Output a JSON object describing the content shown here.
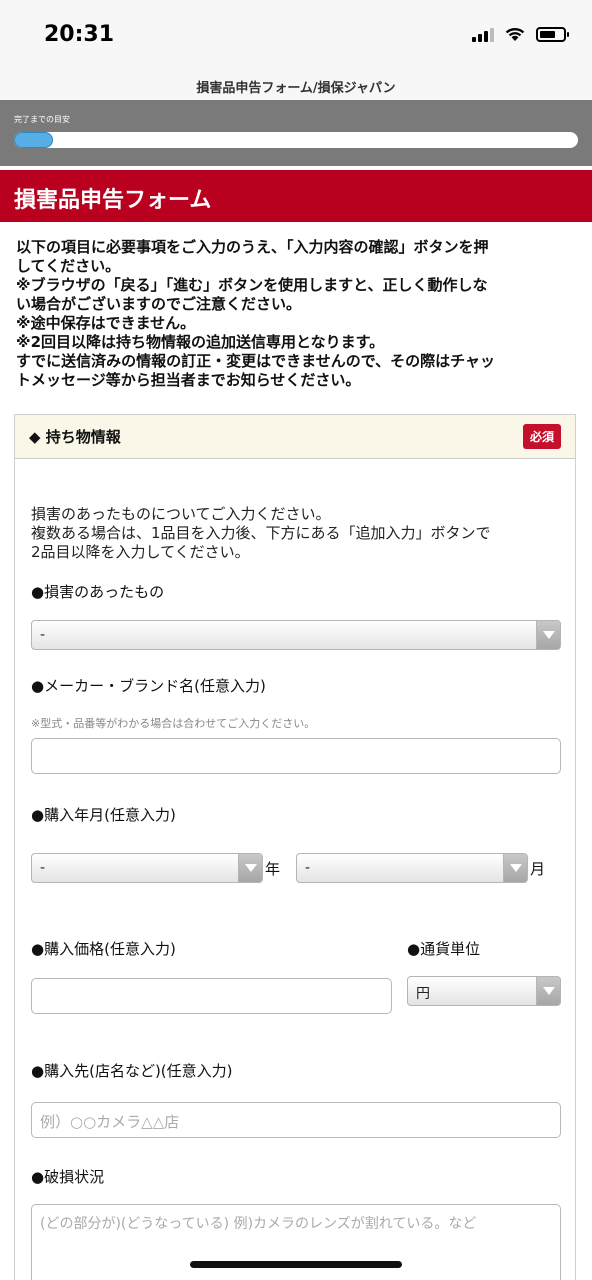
{
  "status": {
    "time": "20:31"
  },
  "site_title": "損害品申告フォーム/損保ジャパン",
  "progress": {
    "label": "完了までの目安",
    "fraction": 0.07
  },
  "form_title": "損害品申告フォーム",
  "intro_lines": [
    "以下の項目に必要事項をご入力のうえ、「入力内容の確認」ボタンを押",
    "してください。",
    "※ブラウザの「戻る」「進む」ボタンを使用しますと、正しく動作しな",
    "い場合がございますのでご注意ください。",
    "※途中保存はできません。",
    "※2回目以降は持ち物情報の追加送信専用となります。",
    "すでに送信済みの情報の訂正・変更はできませんので、その際はチャッ",
    "トメッセージ等から担当者までお知らせください。"
  ],
  "section": {
    "title": "◆ 持ち物情報",
    "required_badge": "必須",
    "desc_lines": [
      "損害のあったものについてご入力ください。",
      "複数ある場合は、1品目を入力後、下方にある「追加入力」ボタンで",
      "2品目以降を入力してください。"
    ],
    "damaged_item": {
      "label": "●損害のあったもの",
      "value": "-"
    },
    "maker": {
      "label": "●メーカー・ブランド名(任意入力)",
      "note": "※型式・品番等がわかる場合は合わせてご入力ください。",
      "value": ""
    },
    "purchase_date": {
      "label": "●購入年月(任意入力)",
      "year_value": "-",
      "year_suffix": "年",
      "month_value": "-",
      "month_suffix": "月"
    },
    "price": {
      "label": "●購入価格(任意入力)",
      "value": ""
    },
    "currency": {
      "label": "●通貨単位",
      "value": "円"
    },
    "store": {
      "label": "●購入先(店名など)(任意入力)",
      "placeholder": "例）○○カメラ△△店"
    },
    "damage": {
      "label": "●破損状況",
      "placeholder": "(どの部分が)(どうなっている) 例)カメラのレンズが割れている。など"
    }
  }
}
